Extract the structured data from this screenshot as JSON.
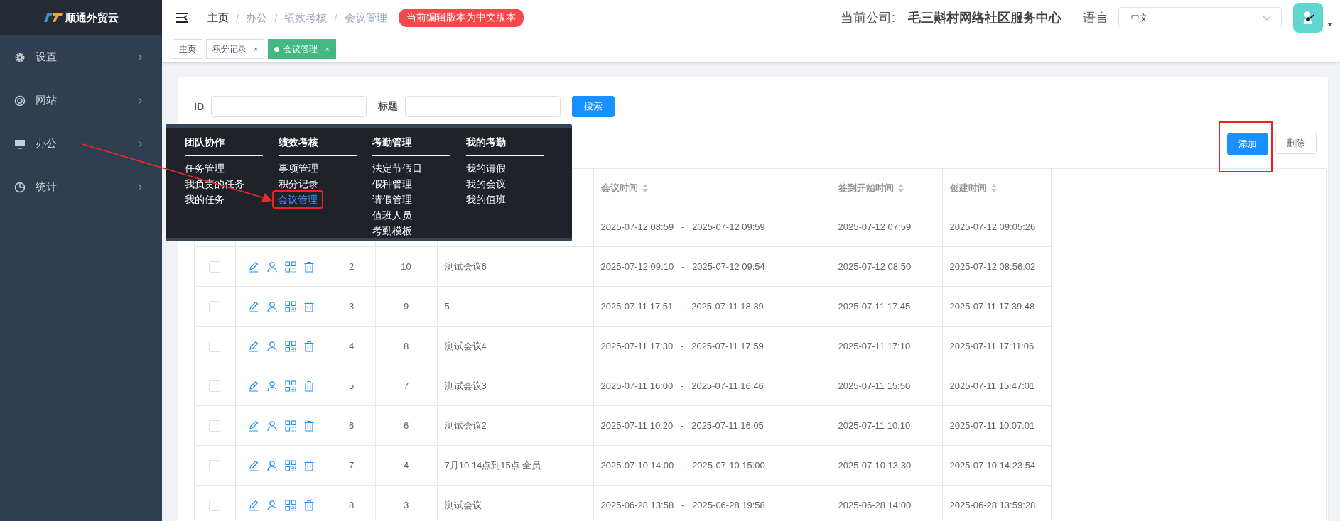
{
  "brand": {
    "name": "顺通外贸云"
  },
  "sidebar": {
    "items": [
      {
        "label": "设置"
      },
      {
        "label": "网站"
      },
      {
        "label": "办公"
      },
      {
        "label": "统计"
      }
    ]
  },
  "header": {
    "breadcrumb": [
      {
        "label": "主页",
        "current": false
      },
      {
        "label": "办公",
        "current": true
      },
      {
        "label": "绩效考核",
        "current": true
      },
      {
        "label": "会议管理",
        "current": true
      }
    ],
    "separator": "/",
    "notice": "当前编辑版本为中文版本",
    "company_label": "当前公司:",
    "company_name": "毛三斢村网络社区服务中心",
    "language_label": "语言",
    "language_select": {
      "value": "中文"
    }
  },
  "tabs": [
    {
      "label": "主页",
      "selected": false,
      "closable": false
    },
    {
      "label": "积分记录",
      "selected": false,
      "closable": true,
      "close": "×"
    },
    {
      "label": "会议管理",
      "selected": true,
      "closable": true,
      "close": "×"
    }
  ],
  "search": {
    "fields": [
      {
        "label": "ID"
      },
      {
        "label": "标题"
      }
    ],
    "button": "搜索"
  },
  "toolbar": {
    "buttons": [
      {
        "label": "添加",
        "kind": "primary",
        "highlighted": true
      },
      {
        "label": "删除",
        "kind": "default",
        "highlighted": false
      }
    ]
  },
  "mega_menu": {
    "columns": [
      {
        "title": "团队协作",
        "items": [
          {
            "label": "任务管理",
            "selected": false,
            "highlighted": false
          },
          {
            "label": "我负责的任务",
            "selected": false,
            "highlighted": false
          },
          {
            "label": "我的任务",
            "selected": false,
            "highlighted": false
          }
        ]
      },
      {
        "title": "绩效考核",
        "items": [
          {
            "label": "事项管理",
            "selected": false,
            "highlighted": false
          },
          {
            "label": "积分记录",
            "selected": false,
            "highlighted": false
          },
          {
            "label": "会议管理",
            "selected": true,
            "highlighted": true
          }
        ]
      },
      {
        "title": "考勤管理",
        "items": [
          {
            "label": "法定节假日",
            "selected": false,
            "highlighted": false
          },
          {
            "label": "假种管理",
            "selected": false,
            "highlighted": false
          },
          {
            "label": "请假管理",
            "selected": false,
            "highlighted": false
          },
          {
            "label": "值班人员",
            "selected": false,
            "highlighted": false
          },
          {
            "label": "考勤模板",
            "selected": false,
            "highlighted": false
          }
        ]
      },
      {
        "title": "我的考勤",
        "items": [
          {
            "label": "我的请假",
            "selected": false,
            "highlighted": false
          },
          {
            "label": "我的会议",
            "selected": false,
            "highlighted": false
          },
          {
            "label": "我的值班",
            "selected": false,
            "highlighted": false
          }
        ]
      }
    ]
  },
  "table": {
    "columns": [
      {
        "label": "会议时间"
      },
      {
        "label": "签到开始时间"
      },
      {
        "label": "创建时间"
      }
    ],
    "rows": [
      {
        "meeting_time": "2025-07-12 08:59   -   2025-07-12 09:59",
        "checkin_start": "2025-07-12 07:59",
        "created": "2025-07-12 09:05:26"
      },
      {
        "checked": false,
        "no": "2",
        "column_4": "10",
        "title": "测试会议6",
        "meeting_time": "2025-07-12 09:10   -   2025-07-12 09:54",
        "checkin_start": "2025-07-12 08:50",
        "created": "2025-07-12 08:56:02"
      },
      {
        "checked": false,
        "no": "3",
        "column_4": "9",
        "title": "5",
        "meeting_time": "2025-07-11 17:51   -   2025-07-11 18:39",
        "checkin_start": "2025-07-11 17:45",
        "created": "2025-07-11 17:39:48"
      },
      {
        "checked": false,
        "no": "4",
        "column_4": "8",
        "title": "测试会议4",
        "meeting_time": "2025-07-11 17:30   -   2025-07-11 17:59",
        "checkin_start": "2025-07-11 17:10",
        "created": "2025-07-11 17:11:06"
      },
      {
        "checked": false,
        "no": "5",
        "column_4": "7",
        "title": "测试会议3",
        "meeting_time": "2025-07-11 16:00   -   2025-07-11 16:46",
        "checkin_start": "2025-07-11 15:50",
        "created": "2025-07-11 15:47:01"
      },
      {
        "checked": false,
        "no": "6",
        "column_4": "6",
        "title": "测试会议2",
        "meeting_time": "2025-07-11 10:20   -   2025-07-11 16:05",
        "checkin_start": "2025-07-11 10:10",
        "created": "2025-07-11 10:07:01"
      },
      {
        "checked": false,
        "no": "7",
        "column_4": "4",
        "title": "7月10 14点到15点 全员",
        "meeting_time": "2025-07-10 14:00   -   2025-07-10 15:00",
        "checkin_start": "2025-07-10 13:30",
        "created": "2025-07-10 14:23:54"
      },
      {
        "checked": false,
        "no": "8",
        "column_4": "3",
        "title": "测试会议",
        "meeting_time": "2025-06-28 13:58   -   2025-06-28 19:58",
        "checkin_start": "2025-06-28 14:00",
        "created": "2025-06-28 13:59:28"
      }
    ]
  }
}
